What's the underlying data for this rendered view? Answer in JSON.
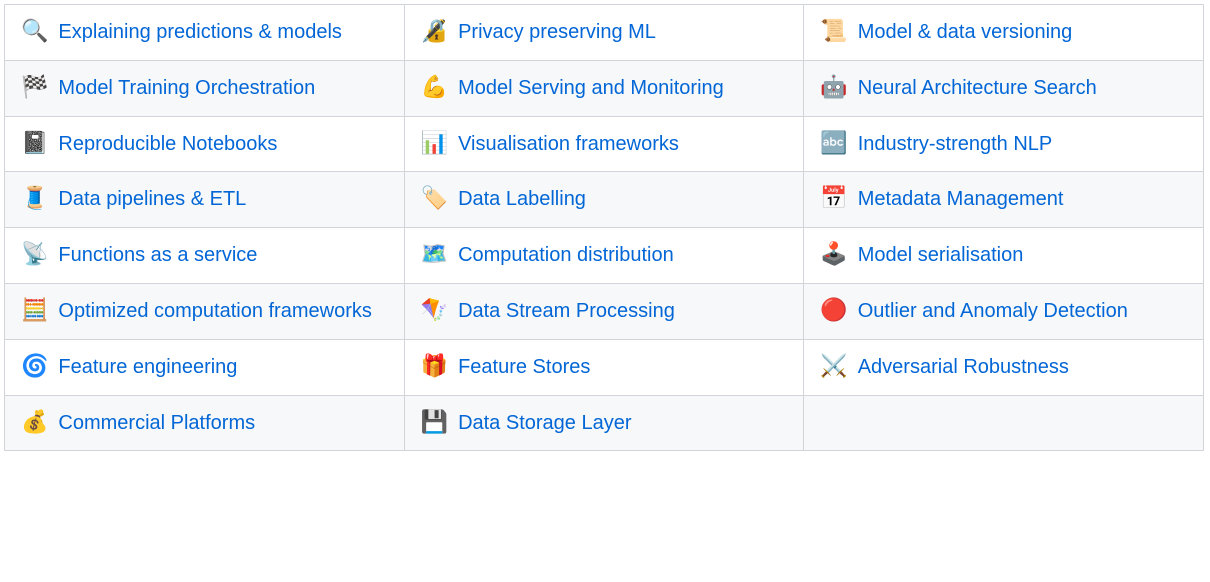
{
  "rows": [
    [
      {
        "icon": "🔍",
        "icon_name": "magnifier-icon",
        "label": "Explaining predictions & models"
      },
      {
        "icon": "🔏",
        "icon_name": "lock-icon",
        "label": "Privacy preserving ML"
      },
      {
        "icon": "📜",
        "icon_name": "scroll-icon",
        "label": "Model & data versioning"
      }
    ],
    [
      {
        "icon": "🏁",
        "icon_name": "checkered-flag-icon",
        "label": "Model Training Orchestration"
      },
      {
        "icon": "💪",
        "icon_name": "flexed-biceps-icon",
        "label": "Model Serving and Monitoring"
      },
      {
        "icon": "🤖",
        "icon_name": "robot-icon",
        "label": "Neural Architecture Search"
      }
    ],
    [
      {
        "icon": "📓",
        "icon_name": "notebook-icon",
        "label": "Reproducible Notebooks"
      },
      {
        "icon": "📊",
        "icon_name": "bar-chart-icon",
        "label": "Visualisation frameworks"
      },
      {
        "icon": "🔤",
        "icon_name": "abc-icon",
        "label": "Industry-strength NLP"
      }
    ],
    [
      {
        "icon": "🧵",
        "icon_name": "thread-icon",
        "label": "Data pipelines & ETL"
      },
      {
        "icon": "🏷️",
        "icon_name": "label-icon",
        "label": "Data Labelling"
      },
      {
        "icon": "📅",
        "icon_name": "calendar-icon",
        "label": "Metadata Management"
      }
    ],
    [
      {
        "icon": "📡",
        "icon_name": "satellite-icon",
        "label": "Functions as a service"
      },
      {
        "icon": "🗺️",
        "icon_name": "map-icon",
        "label": "Computation distribution"
      },
      {
        "icon": "🕹️",
        "icon_name": "joystick-icon",
        "label": "Model serialisation"
      }
    ],
    [
      {
        "icon": "🧮",
        "icon_name": "abacus-icon",
        "label": "Optimized computation frameworks"
      },
      {
        "icon": "🪁",
        "icon_name": "kite-icon",
        "label": "Data Stream Processing"
      },
      {
        "icon": "🔴",
        "icon_name": "red-circle-icon",
        "label": "Outlier and Anomaly Detection"
      }
    ],
    [
      {
        "icon": "🌀",
        "icon_name": "cyclone-icon",
        "label": "Feature engineering"
      },
      {
        "icon": "🎁",
        "icon_name": "gift-icon",
        "label": "Feature Stores"
      },
      {
        "icon": "⚔️",
        "icon_name": "crossed-swords-icon",
        "label": "Adversarial Robustness"
      }
    ],
    [
      {
        "icon": "💰",
        "icon_name": "money-bag-icon",
        "label": "Commercial Platforms"
      },
      {
        "icon": "💾",
        "icon_name": "floppy-disk-icon",
        "label": "Data Storage Layer"
      },
      null
    ]
  ]
}
